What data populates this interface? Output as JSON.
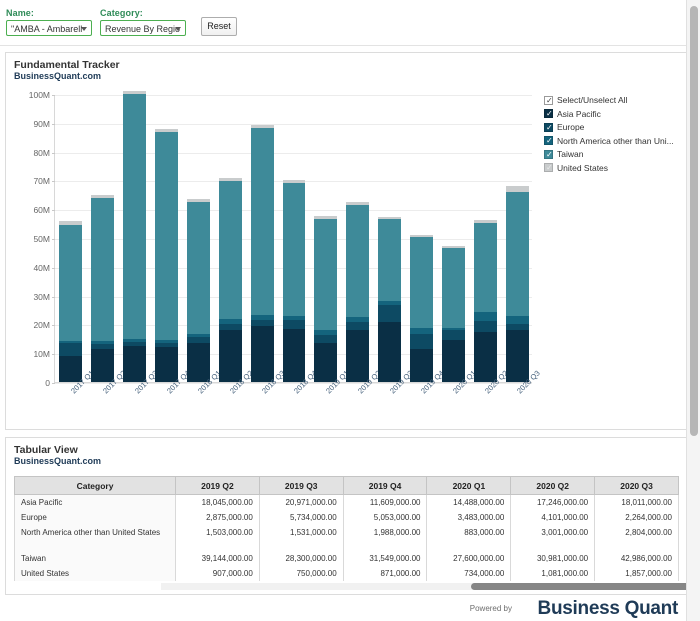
{
  "filters": {
    "name_label": "Name:",
    "name_value": "\"AMBA - Ambarell",
    "category_label": "Category:",
    "category_value": "Revenue By Regio",
    "reset_label": "Reset"
  },
  "chart_card": {
    "title": "Fundamental Tracker",
    "subtitle": "BusinessQuant.com"
  },
  "table_card": {
    "title": "Tabular View",
    "subtitle": "BusinessQuant.com"
  },
  "legend": {
    "select_all": "Select/Unselect All",
    "items": [
      {
        "label": "Asia Pacific",
        "color": "#0a2f45",
        "checked": true
      },
      {
        "label": "Europe",
        "color": "#0d4a63",
        "checked": true
      },
      {
        "label": "North America other than Uni...",
        "color": "#14647d",
        "checked": true
      },
      {
        "label": "Taiwan",
        "color": "#3e8a99",
        "checked": true
      },
      {
        "label": "United States",
        "color": "#c9cccd",
        "checked": true
      }
    ]
  },
  "table": {
    "columns": [
      "Category",
      "2019 Q2",
      "2019 Q3",
      "2019 Q4",
      "2020 Q1",
      "2020 Q2",
      "2020 Q3"
    ],
    "rows": [
      {
        "category": "Asia Pacific",
        "values": [
          "18,045,000.00",
          "20,971,000.00",
          "11,609,000.00",
          "14,488,000.00",
          "17,246,000.00",
          "18,011,000.00"
        ]
      },
      {
        "category": "Europe",
        "values": [
          "2,875,000.00",
          "5,734,000.00",
          "5,053,000.00",
          "3,483,000.00",
          "4,101,000.00",
          "2,264,000.00"
        ]
      },
      {
        "category": "North America other than United States",
        "values": [
          "1,503,000.00",
          "1,531,000.00",
          "1,988,000.00",
          "883,000.00",
          "3,001,000.00",
          "2,804,000.00"
        ]
      },
      {
        "category": "Taiwan",
        "values": [
          "39,144,000.00",
          "28,300,000.00",
          "31,549,000.00",
          "27,600,000.00",
          "30,981,000.00",
          "42,986,000.00"
        ]
      },
      {
        "category": "United States",
        "values": [
          "907,000.00",
          "750,000.00",
          "871,000.00",
          "734,000.00",
          "1,081,000.00",
          "1,857,000.00"
        ]
      }
    ]
  },
  "footer": {
    "powered_by": "Powered by",
    "brand": "Business Quant"
  },
  "chart_data": {
    "type": "bar",
    "stacked": true,
    "title": "Fundamental Tracker",
    "subtitle": "BusinessQuant.com",
    "xlabel": "",
    "ylabel": "",
    "ylim": [
      0,
      100000000
    ],
    "ytick_labels": [
      "0",
      "10M",
      "20M",
      "30M",
      "40M",
      "50M",
      "60M",
      "70M",
      "80M",
      "90M",
      "100M"
    ],
    "ytick_values": [
      0,
      10000000,
      20000000,
      30000000,
      40000000,
      50000000,
      60000000,
      70000000,
      80000000,
      90000000,
      100000000
    ],
    "grid": true,
    "legend_position": "right",
    "categories": [
      "2017 Q1",
      "2017 Q2",
      "2017 Q3",
      "2017 Q4",
      "2018 Q1",
      "2018 Q2",
      "2018 Q3",
      "2018 Q4",
      "2019 Q1",
      "2019 Q2",
      "2019 Q3",
      "2019 Q4",
      "2020 Q1",
      "2020 Q2",
      "2020 Q3"
    ],
    "series": [
      {
        "name": "Asia Pacific",
        "color": "#0a2f45",
        "values": [
          9000000,
          11500000,
          12500000,
          12000000,
          13500000,
          18000000,
          19500000,
          18500000,
          13500000,
          18045000,
          20971000,
          11609000,
          14488000,
          17246000,
          18011000
        ]
      },
      {
        "name": "Europe",
        "color": "#0d4a63",
        "values": [
          4500000,
          1800000,
          1500000,
          1600000,
          2000000,
          2300000,
          2200000,
          3000000,
          3000000,
          2875000,
          5734000,
          5053000,
          3483000,
          4101000,
          2264000
        ]
      },
      {
        "name": "North America other than United States",
        "color": "#14647d",
        "values": [
          700000,
          1000000,
          900000,
          900000,
          1200000,
          1500000,
          1400000,
          1500000,
          1700000,
          1503000,
          1531000,
          1988000,
          883000,
          3001000,
          2804000
        ]
      },
      {
        "name": "Taiwan",
        "color": "#3e8a99",
        "values": [
          40500000,
          49700000,
          85100000,
          72300000,
          45800000,
          48000000,
          65000000,
          46000000,
          38500000,
          39144000,
          28300000,
          31549000,
          27600000,
          30981000,
          42986000
        ]
      },
      {
        "name": "United States",
        "color": "#c9cccd",
        "values": [
          1300000,
          1000000,
          1000000,
          1200000,
          1000000,
          900000,
          1100000,
          1000000,
          1000000,
          907000,
          750000,
          871000,
          734000,
          1081000,
          1857000
        ]
      }
    ]
  }
}
